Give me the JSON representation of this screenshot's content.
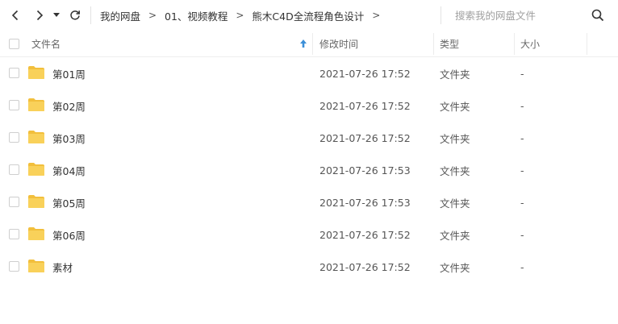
{
  "toolbar": {
    "back_icon": "chevron-left-icon",
    "forward_icon": "chevron-right-icon",
    "dropdown_icon": "caret-down-icon",
    "refresh_icon": "refresh-icon",
    "breadcrumb": [
      "我的网盘",
      "01、视频教程",
      "熊木C4D全流程角色设计"
    ],
    "breadcrumb_separator": ">",
    "search": {
      "placeholder": "搜索我的网盘文件",
      "value": ""
    }
  },
  "header": {
    "name": "文件名",
    "modified": "修改时间",
    "type": "类型",
    "size": "大小",
    "sort_icon": "sort-up-arrow-icon"
  },
  "files": [
    {
      "name": "第01周",
      "modified": "2021-07-26 17:52",
      "type": "文件夹",
      "size": "-"
    },
    {
      "name": "第02周",
      "modified": "2021-07-26 17:52",
      "type": "文件夹",
      "size": "-"
    },
    {
      "name": "第03周",
      "modified": "2021-07-26 17:52",
      "type": "文件夹",
      "size": "-"
    },
    {
      "name": "第04周",
      "modified": "2021-07-26 17:53",
      "type": "文件夹",
      "size": "-"
    },
    {
      "name": "第05周",
      "modified": "2021-07-26 17:53",
      "type": "文件夹",
      "size": "-"
    },
    {
      "name": "第06周",
      "modified": "2021-07-26 17:52",
      "type": "文件夹",
      "size": "-"
    },
    {
      "name": "素材",
      "modified": "2021-07-26 17:52",
      "type": "文件夹",
      "size": "-"
    }
  ],
  "colors": {
    "folder": "#f9d15a",
    "folder_back": "#f2bf3c",
    "sort_arrow": "#3c8fd8",
    "divider": "#eeeeee"
  }
}
